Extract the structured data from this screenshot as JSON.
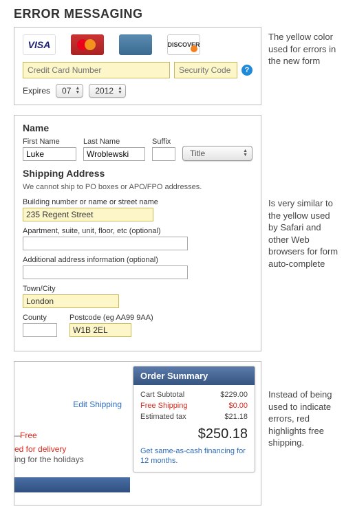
{
  "page_title": "ERROR MESSAGING",
  "annotations": {
    "a1": "The yellow color used for errors in the new form",
    "a2": "Is very similar to the yellow used by Safari and other Web browsers for form auto-complete",
    "a3": "Instead of being used to indicate errors, red highlights free shipping."
  },
  "cc": {
    "number_placeholder": "Credit Card Number",
    "security_placeholder": "Security Code",
    "expires_label": "Expires",
    "month": "07",
    "year": "2012",
    "logos": {
      "visa": "VISA",
      "amex": "AMEX",
      "discover": "DISCOVER"
    }
  },
  "name_section": {
    "heading": "Name",
    "first_label": "First Name",
    "first_value": "Luke",
    "last_label": "Last Name",
    "last_value": "Wroblewski",
    "suffix_label": "Suffix",
    "title_select": "Title"
  },
  "shipping": {
    "heading": "Shipping Address",
    "note": "We cannot ship to PO boxes or APO/FPO addresses.",
    "street_label": "Building number or name or street name",
    "street_value": "235 Regent Street",
    "apt_label": "Apartment, suite, unit, floor, etc (optional)",
    "extra_label": "Additional address information (optional)",
    "town_label": "Town/City",
    "town_value": "London",
    "county_label": "County",
    "postcode_label": "Postcode (eg AA99 9AA)",
    "postcode_value": "W1B 2EL"
  },
  "summary": {
    "edit_link": "Edit Shipping",
    "free_prefix": "—",
    "free_text": "Free",
    "delivery_frag": "ed for delivery",
    "holidays_frag": "ing for the holidays",
    "header": "Order Summary",
    "subtotal_label": "Cart Subtotal",
    "subtotal_value": "$229.00",
    "shipping_label": "Free Shipping",
    "shipping_value": "$0.00",
    "tax_label": "Estimated tax",
    "tax_value": "$21.18",
    "total": "$250.18",
    "finance": "Get same-as-cash financing for 12 months."
  }
}
